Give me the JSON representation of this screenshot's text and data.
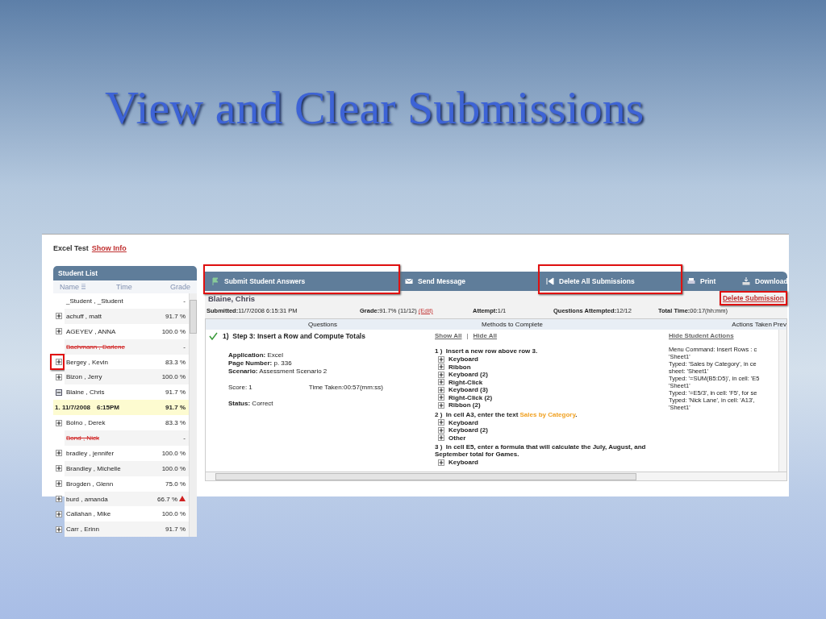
{
  "slide_title": "View and Clear Submissions",
  "test": {
    "name": "Excel Test",
    "link": "Show Info"
  },
  "student_list": {
    "title": "Student List",
    "columns": [
      "Name",
      "Time",
      "Grade"
    ],
    "rows": [
      {
        "kind": "plain",
        "name": "_Student , _Student",
        "grade": "-",
        "highlighted": false,
        "warning": false
      },
      {
        "kind": "student",
        "name": "achuff , matt",
        "grade": "91.7 %",
        "expanded": false,
        "highlighted": false,
        "warning": false
      },
      {
        "kind": "student",
        "name": "AGEYEV , ANNA",
        "grade": "100.0 %",
        "expanded": false,
        "highlighted": false,
        "warning": false
      },
      {
        "kind": "deleted",
        "name": "Bachmann , Darlene",
        "grade": "-",
        "highlighted": false,
        "warning": false
      },
      {
        "kind": "student",
        "name": "Bergey , Kevin",
        "grade": "83.3 %",
        "expanded": false,
        "highlighted": true,
        "warning": false
      },
      {
        "kind": "student",
        "name": "Bizon , Jerry",
        "grade": "100.0 %",
        "expanded": false,
        "highlighted": false,
        "warning": false
      },
      {
        "kind": "student",
        "name": "Blaine , Chris",
        "grade": "91.7 %",
        "expanded": true,
        "highlighted": false,
        "warning": false
      },
      {
        "kind": "attempt",
        "name": "1. 11/7/2008",
        "time": "6:15PM",
        "grade": "91.7 %",
        "warning": false
      },
      {
        "kind": "student",
        "name": "Bolno , Derek",
        "grade": "83.3 %",
        "expanded": false,
        "highlighted": false,
        "warning": false
      },
      {
        "kind": "deleted",
        "name": "Bond , Nick",
        "grade": "-",
        "highlighted": false,
        "warning": false
      },
      {
        "kind": "student",
        "name": "bradley , jennifer",
        "grade": "100.0 %",
        "expanded": false,
        "highlighted": false,
        "warning": false
      },
      {
        "kind": "student",
        "name": "Brandley , Michelle",
        "grade": "100.0 %",
        "expanded": false,
        "highlighted": false,
        "warning": false
      },
      {
        "kind": "student",
        "name": "Brogden , Glenn",
        "grade": "75.0 %",
        "expanded": false,
        "highlighted": false,
        "warning": false
      },
      {
        "kind": "student",
        "name": "burd , amanda",
        "grade": "66.7 %",
        "expanded": false,
        "highlighted": false,
        "warning": true
      },
      {
        "kind": "student",
        "name": "Callahan , Mike",
        "grade": "100.0 %",
        "expanded": false,
        "highlighted": false,
        "warning": false
      },
      {
        "kind": "student",
        "name": "Carr , Erinn",
        "grade": "91.7 %",
        "expanded": false,
        "highlighted": false,
        "warning": false
      }
    ]
  },
  "toolbar": [
    {
      "kind": "submit",
      "label": "Submit Student Answers",
      "highlighted": true
    },
    {
      "kind": "message",
      "label": "Send Message",
      "highlighted": false
    },
    {
      "kind": "delete_all",
      "label": "Delete All Submissions",
      "highlighted": true
    },
    {
      "kind": "print",
      "label": "Print",
      "highlighted": false
    },
    {
      "kind": "download",
      "label": "Download",
      "highlighted": false
    }
  ],
  "submission": {
    "student": "Blaine, Chris",
    "delete_link": "Delete Submission",
    "delete_highlighted": true,
    "info": [
      {
        "label": "Submitted:",
        "value": "11/7/2008 6:15:31 PM"
      },
      {
        "label": "Grade:",
        "value": "91.7% (11/12)",
        "link": "(Edit)"
      },
      {
        "label": "Attempt:",
        "value": "1/1"
      },
      {
        "label": "Questions Attempted:",
        "value": "12/12"
      },
      {
        "label": "Total Time:",
        "value": "00:17(hh:mm)"
      }
    ],
    "columns": [
      "Questions",
      "Methods to Complete",
      "Actions Taken",
      "Prev"
    ],
    "question": {
      "number": "1)",
      "title": "Step 3: Insert a Row and Compute Totals",
      "correct": true,
      "details": [
        {
          "label": "Application:",
          "value": "Excel"
        },
        {
          "label": "Page Number:",
          "value": "p. 336"
        },
        {
          "label": "Scenario:",
          "value": "Assessment Scenario 2"
        }
      ],
      "score": "Score: 1",
      "time_taken": "Time Taken:00:57(mm:ss)",
      "status_label": "Status:",
      "status": "Correct"
    },
    "method_links": [
      "Show All",
      "Hide All"
    ],
    "method_link_separator": "|",
    "steps": [
      {
        "number": "1 )",
        "text": "Insert a new row above row 3.",
        "methods": [
          "Keyboard",
          "Ribbon",
          "Keyboard (2)",
          "Right-Click",
          "Keyboard (3)",
          "Right-Click (2)",
          "Ribbon (2)"
        ]
      },
      {
        "number": "2 )",
        "text": "In cell A3, enter the text ",
        "highlight": "Sales by Category",
        "after": ".",
        "methods": [
          "Keyboard",
          "Keyboard (2)",
          "Other"
        ]
      },
      {
        "number": "3 )",
        "text": "In cell E5, enter a formula that will calculate the July, August, and September total for Games.",
        "methods": [
          "Keyboard"
        ]
      }
    ],
    "actions_link": "Hide Student Actions",
    "actions": [
      "Menu Command: Insert Rows : c",
      "'Sheet1'",
      "Typed: 'Sales by Category', in ce",
      "sheet: 'Sheet1'",
      "Typed: '=SUM(B5:D5)', in cell: 'E5",
      "'Sheet1'",
      "Typed: '=E5/3', in cell: 'F5', for se",
      "Typed: 'Nick Lane', in cell: 'A13',",
      "'Sheet1'"
    ]
  }
}
